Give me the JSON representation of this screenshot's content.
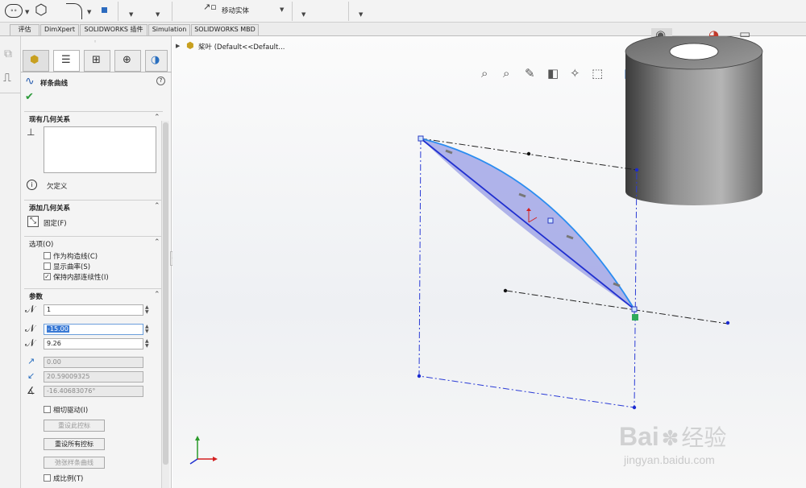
{
  "toolbar": {
    "move_solid": "移动实体"
  },
  "tabs": [
    "评估",
    "DimXpert",
    "SOLIDWORKS 插件",
    "Simulation",
    "SOLIDWORKS MBD"
  ],
  "feature_tree": {
    "part_label": "桨叶  (Default<<Default..."
  },
  "panel": {
    "title": "样条曲线",
    "existing_relations": {
      "title": "现有几何关系",
      "status": "欠定义"
    },
    "add_relations": {
      "title": "添加几何关系",
      "fixed": "固定(F)"
    },
    "options": {
      "title": "选项(O)",
      "items": [
        {
          "label": "作为构造线(C)",
          "checked": false
        },
        {
          "label": "显示曲率(S)",
          "checked": false
        },
        {
          "label": "保持内部连续性(I)",
          "checked": true
        }
      ]
    },
    "params": {
      "title": "参数",
      "point_index": "1",
      "x": "-15.00",
      "y": "9.26",
      "tangent_weight": "0.00",
      "radius": "20.59009325",
      "angle": "-16.40683076°",
      "tangent_driving": "相切驱动(I)",
      "reset_this": "重设此控标",
      "reset_all": "重设所有控标",
      "relax": "弛张样条曲线",
      "proportional": "成比例(T)"
    }
  },
  "watermark": {
    "brand_latin": "Bai",
    "brand_cn": "经验",
    "url": "jingyan.baidu.com"
  }
}
